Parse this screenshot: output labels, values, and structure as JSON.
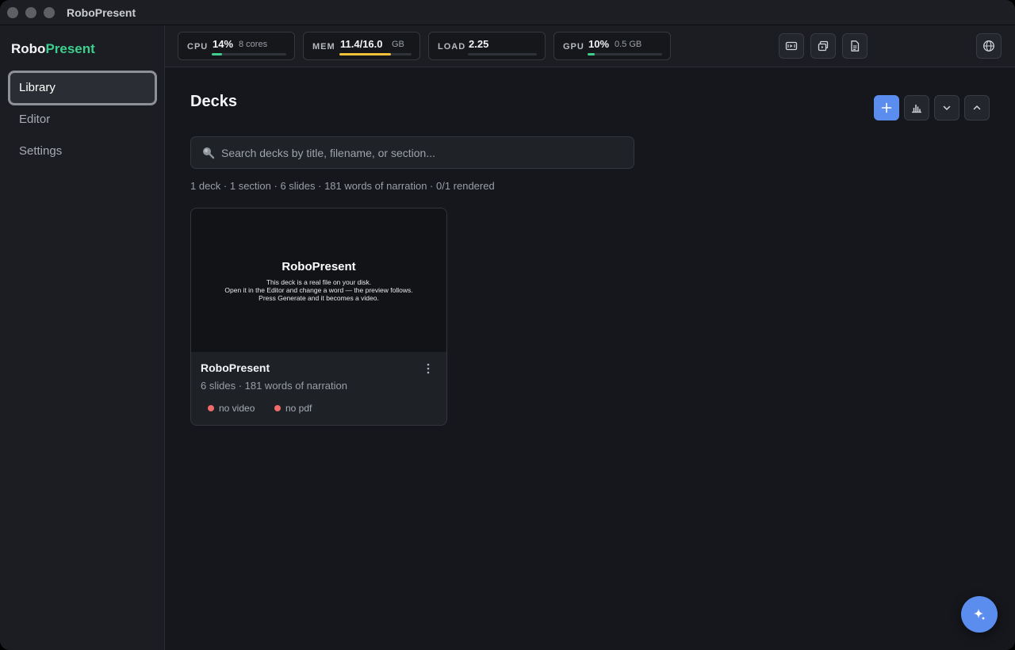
{
  "app": {
    "title": "RoboPresent"
  },
  "brand": {
    "part1": "Robo",
    "part2": "Present",
    "accent_color": "#3ecf8e"
  },
  "sidebar": {
    "items": [
      {
        "label": "Library",
        "active": true
      },
      {
        "label": "Editor",
        "active": false
      },
      {
        "label": "Settings",
        "active": false
      }
    ]
  },
  "metrics": {
    "cpu": {
      "label": "CPU",
      "value": "14%",
      "sub": "8 cores",
      "fraction": 0.14,
      "color": "#3ecf8e"
    },
    "mem": {
      "label": "MEM",
      "value": "11.4/16.0",
      "sub": "GB",
      "fraction": 0.71,
      "color": "#f0c23a"
    },
    "load": {
      "label": "LOAD",
      "value": "2.25",
      "sub": "",
      "fraction": 0.0,
      "color": "#3ecf8e"
    },
    "gpu": {
      "label": "GPU",
      "value": "10%",
      "sub": "0.5 GB",
      "fraction": 0.1,
      "color": "#3ecf8e"
    }
  },
  "toolbar_icons": [
    "video-icon",
    "copy-icon",
    "document-icon",
    "globe-icon"
  ],
  "main": {
    "title": "Decks",
    "actions": [
      "plus-icon",
      "bar-chart-icon",
      "chevron-down-icon",
      "chevron-up-icon"
    ],
    "search": {
      "placeholder": "Search decks by title, filename, or section..."
    },
    "summary": "1 deck · 1 section · 6 slides · 181 words of narration · 0/1 rendered"
  },
  "decks": [
    {
      "title": "RoboPresent",
      "meta": "6 slides · 181 words of narration",
      "preview": {
        "title": "RoboPresent",
        "lines": [
          "This deck is a real file on your disk.",
          "Open it in the Editor and change a word — the preview follows.",
          "Press Generate and it becomes a video."
        ]
      },
      "badges": [
        {
          "label": "no video",
          "color": "#f06a6a"
        },
        {
          "label": "no pdf",
          "color": "#f06a6a"
        }
      ]
    }
  ],
  "colors": {
    "primary": "#5b8def"
  }
}
